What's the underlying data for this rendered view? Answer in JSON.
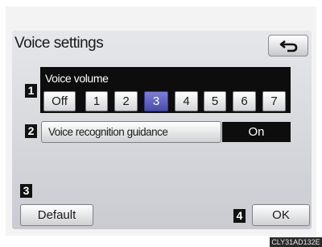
{
  "screen": {
    "title": "Voice settings"
  },
  "markers": [
    "1",
    "2",
    "3",
    "4"
  ],
  "voice_volume": {
    "label": "Voice volume",
    "options": [
      "Off",
      "1",
      "2",
      "3",
      "4",
      "5",
      "6",
      "7"
    ],
    "selected": "3"
  },
  "guidance": {
    "label": "Voice recognition guidance",
    "status": "On"
  },
  "buttons": {
    "default_label": "Default",
    "ok_label": "OK"
  },
  "image_code": "CLY31AD132E",
  "icons": {
    "back": "back-arrow-icon"
  },
  "colors": {
    "selected_accent": "#5a5cc0",
    "panel": "#0d0d0d"
  }
}
